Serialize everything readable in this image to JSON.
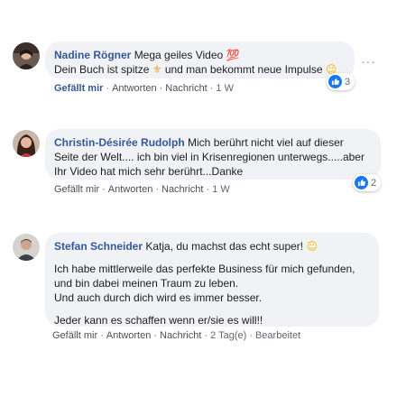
{
  "comments": [
    {
      "name": "Nadine Rögner",
      "text_line1": "Mega geiles Video 💯",
      "text_line2_a": "Dein Buch ist spitze ",
      "text_line2_b": " und man bekommt neue Impulse ",
      "actions": {
        "like": "Gefällt mir",
        "reply": "Antworten",
        "message": "Nachricht",
        "time": "1 W"
      },
      "reaction_count": "3",
      "more": "···"
    },
    {
      "name": "Christin-Désirée Rudolph",
      "text_inline": " Mich berührt nicht viel auf dieser",
      "text_rest": "Seite der Welt.... ich bin viel in Krisenregionen unterwegs.....aber\nIhr Video hat mich sehr berührt...Danke",
      "actions": {
        "like": "Gefällt mir",
        "reply": "Antworten",
        "message": "Nachricht",
        "time": "1 W"
      },
      "reaction_count": "2"
    },
    {
      "name": "Stefan Schneider",
      "text_inline": " Katja, du machst das echt super! ",
      "para1": "Ich habe mittlerweile das perfekte Business für mich gefunden,\nund bin dabei meinen Traum zu leben.\nUnd auch durch dich wird es immer besser.",
      "para2": "Jeder kann es schaffen wenn er/sie es will!!",
      "actions": {
        "like": "Gefällt mir",
        "reply": "Antworten",
        "message": "Nachricht",
        "time": "2 Tag(e)",
        "edited": "Bearbeitet"
      }
    }
  ],
  "colors": {
    "bubble": "#f0f2f5",
    "link": "#365899",
    "like_blue": "#1877f2"
  }
}
